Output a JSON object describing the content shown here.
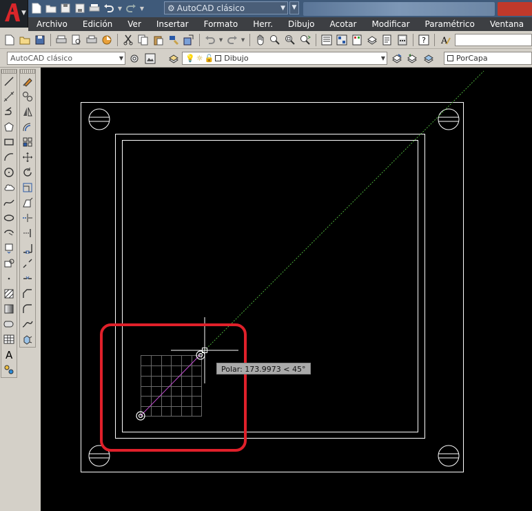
{
  "titlebar": {
    "workspace": "AutoCAD clásico"
  },
  "menu": [
    "Archivo",
    "Edición",
    "Ver",
    "Insertar",
    "Formato",
    "Herr.",
    "Dibujo",
    "Acotar",
    "Modificar",
    "Paramétrico",
    "Ventana",
    "?"
  ],
  "toolbar2": {
    "workspace_combo": "AutoCAD clásico",
    "layer_combo": "Dibujo",
    "color_combo": "PorCapa"
  },
  "canvas": {
    "tooltip": "Polar: 173.9973 < 45°"
  },
  "colors": {
    "menubar": "#3d3f43",
    "titlebar": "#3f5a7a",
    "canvas": "#000000",
    "highlight": "#e0202a",
    "tracking": "#4caf3a"
  },
  "icons": {
    "left_col1": [
      "line-icon",
      "construction-line-icon",
      "polyline-icon",
      "polygon-icon",
      "rectangle-icon",
      "arc-icon",
      "circle-icon",
      "revision-cloud-icon",
      "spline-icon",
      "ellipse-icon",
      "ellipse-arc-icon",
      "insert-block-icon",
      "make-block-icon",
      "point-icon",
      "hatch-icon",
      "gradient-icon",
      "region-icon",
      "table-icon",
      "mtext-icon",
      "add-selected-icon"
    ],
    "left_col2": [
      "erase-icon",
      "copy-icon",
      "mirror-icon",
      "offset-icon",
      "array-icon",
      "move-icon",
      "rotate-icon",
      "scale-icon",
      "stretch-icon",
      "trim-icon",
      "extend-icon",
      "break-at-point-icon",
      "break-icon",
      "join-icon",
      "chamfer-icon",
      "fillet-icon",
      "blend-curves-icon",
      "explode-icon"
    ]
  }
}
